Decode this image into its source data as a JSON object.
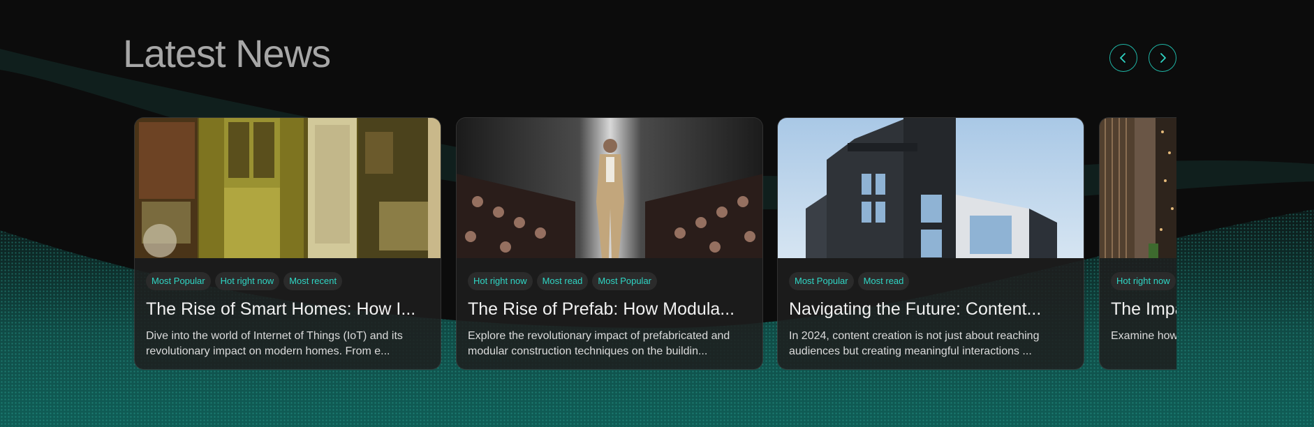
{
  "section": {
    "title": "Latest News"
  },
  "icons": {
    "prev": "chevron-left-icon",
    "next": "chevron-right-icon"
  },
  "colors": {
    "accent": "#1fb6a6",
    "tag_text": "#2fd6c5",
    "background": "#0c0c0c"
  },
  "cards": [
    {
      "image": "room-interior-image",
      "tags": [
        "Most Popular",
        "Hot right now",
        "Most recent"
      ],
      "title": "The Rise of Smart Homes: How I...",
      "description": "Dive into the world of Internet of Things (IoT) and its revolutionary impact on modern homes. From e..."
    },
    {
      "image": "fashion-runway-image",
      "tags": [
        "Hot right now",
        "Most read",
        "Most Popular"
      ],
      "title": "The Rise of Prefab: How Modula...",
      "description": "Explore the revolutionary impact of prefabricated and modular construction techniques on the buildin..."
    },
    {
      "image": "modern-building-image",
      "tags": [
        "Most Popular",
        "Most read"
      ],
      "title": "Navigating the Future: Content...",
      "description": "In 2024, content creation is not just about reaching audiences but creating meaningful interactions ..."
    },
    {
      "image": "building-facade-image",
      "tags": [
        "Hot right now"
      ],
      "title": "The Impa",
      "description": "Examine how industry and c"
    }
  ]
}
